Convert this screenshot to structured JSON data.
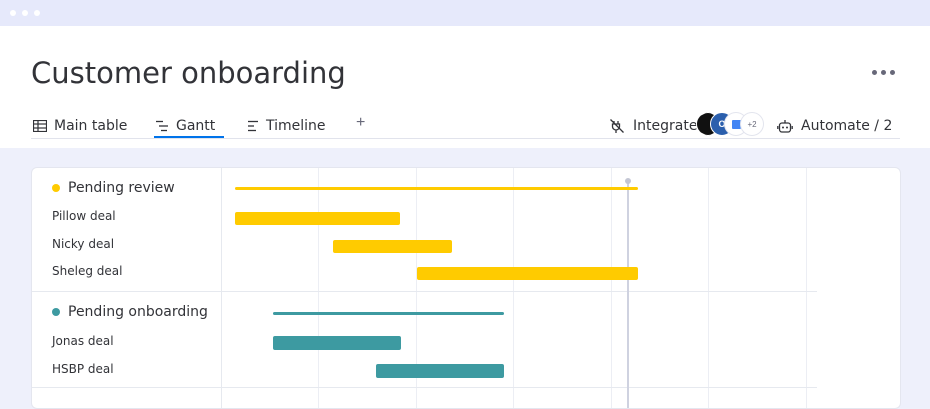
{
  "window": {
    "dots": 3
  },
  "header": {
    "title": "Customer onboarding",
    "more_icon": "more-horizontal-icon"
  },
  "tabs": [
    {
      "label": "Main table",
      "icon": "table-icon",
      "active": false
    },
    {
      "label": "Gantt",
      "icon": "gantt-icon",
      "active": true
    },
    {
      "label": "Timeline",
      "icon": "timeline-icon",
      "active": false
    }
  ],
  "add_tab_label": "+",
  "integrate": {
    "label": "Integrate",
    "icon": "integrate-plug-icon",
    "extra_count": "+2"
  },
  "automate": {
    "label": "Automate / 2",
    "icon": "robot-icon"
  },
  "colors": {
    "accent": "#0073ea",
    "pending_review": "#ffcb00",
    "pending_onboarding": "#3d9aa1"
  },
  "groups": [
    {
      "name": "Pending review",
      "color": "#ffcb00",
      "items": [
        "Pillow deal",
        "Nicky deal",
        "Sheleg deal"
      ]
    },
    {
      "name": "Pending onboarding",
      "color": "#3d9aa1",
      "items": [
        "Jonas deal",
        "HSBP deal"
      ]
    }
  ]
}
